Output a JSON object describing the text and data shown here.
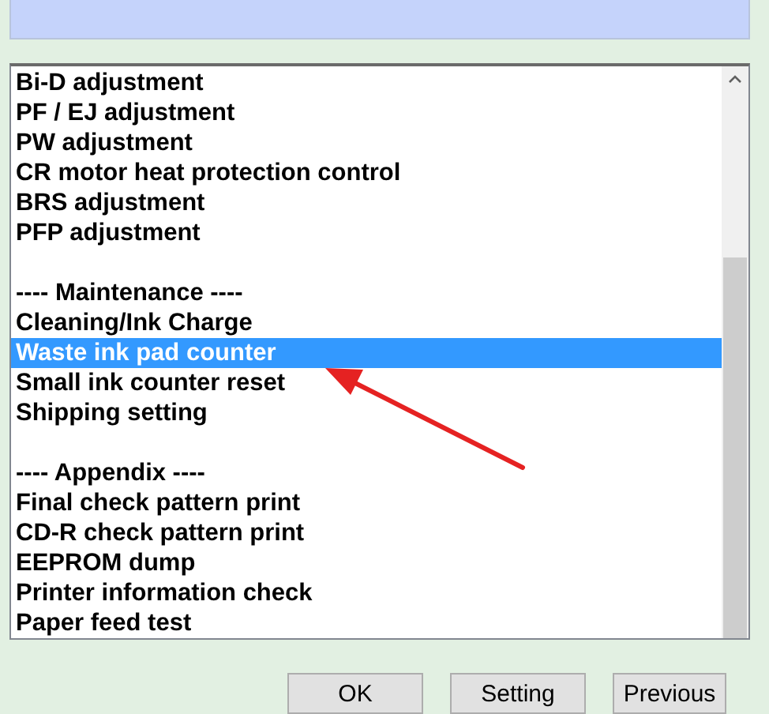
{
  "items": [
    {
      "kind": "item",
      "label": "Bi-D adjustment",
      "selected": false
    },
    {
      "kind": "item",
      "label": "PF / EJ adjustment",
      "selected": false
    },
    {
      "kind": "item",
      "label": "PW adjustment",
      "selected": false
    },
    {
      "kind": "item",
      "label": "CR motor heat protection control",
      "selected": false
    },
    {
      "kind": "item",
      "label": "BRS adjustment",
      "selected": false
    },
    {
      "kind": "item",
      "label": "PFP adjustment",
      "selected": false
    },
    {
      "kind": "spacer"
    },
    {
      "kind": "item",
      "label": "---- Maintenance ----",
      "selected": false
    },
    {
      "kind": "item",
      "label": "Cleaning/Ink Charge",
      "selected": false
    },
    {
      "kind": "item",
      "label": "Waste ink pad counter",
      "selected": true
    },
    {
      "kind": "item",
      "label": "Small ink counter reset",
      "selected": false
    },
    {
      "kind": "item",
      "label": "Shipping setting",
      "selected": false
    },
    {
      "kind": "spacer"
    },
    {
      "kind": "item",
      "label": "---- Appendix ----",
      "selected": false
    },
    {
      "kind": "item",
      "label": "Final check pattern print",
      "selected": false
    },
    {
      "kind": "item",
      "label": "CD-R check pattern print",
      "selected": false
    },
    {
      "kind": "item",
      "label": "EEPROM dump",
      "selected": false
    },
    {
      "kind": "item",
      "label": "Printer information check",
      "selected": false
    },
    {
      "kind": "item",
      "label": "Paper feed test",
      "selected": false
    }
  ],
  "buttons": [
    "OK",
    "Setting",
    "Previous"
  ]
}
